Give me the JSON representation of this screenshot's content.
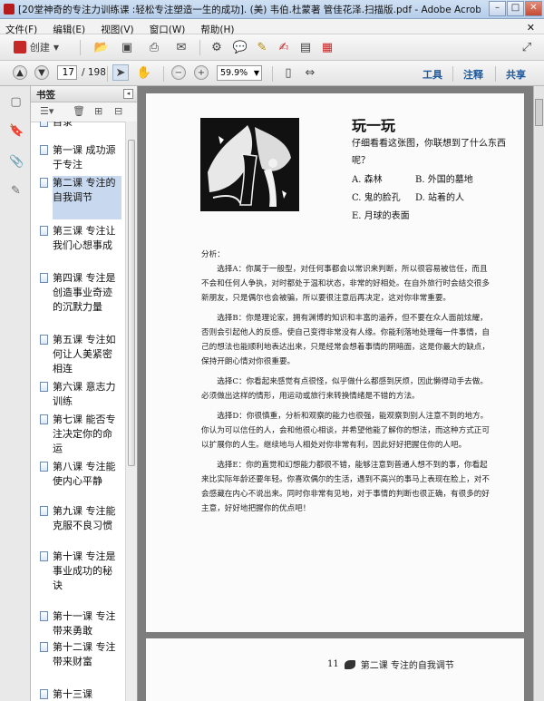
{
  "window": {
    "title": "[20堂神奇的专注力训练课 :轻松专注塑造一生的成功]. (美) 韦伯.杜蒙著 管佳花泽.扫描版.pdf - Adobe Acrobat Pro",
    "buttons": [
      "–",
      "□",
      "✕"
    ]
  },
  "menu": {
    "items": [
      "文件(F)",
      "编辑(E)",
      "视图(V)",
      "窗口(W)",
      "帮助(H)"
    ],
    "close": "✕"
  },
  "toolbar": {
    "create_label": "创建"
  },
  "nav": {
    "page_current": "17",
    "page_total": "/ 198",
    "zoom": "59.9%",
    "panels": [
      "工具",
      "注释",
      "共享"
    ]
  },
  "bookmarks": {
    "header": "书签",
    "items": [
      {
        "label": "目录",
        "selected": false
      },
      {
        "label": "第一课 成功源于专注",
        "selected": false
      },
      {
        "label": "第二课 专注的自我调节",
        "selected": true
      },
      {
        "label": "第三课 专注让我们心想事成",
        "selected": false
      },
      {
        "label": "第四课 专注是创造事业奇迹的沉默力量",
        "selected": false
      },
      {
        "label": "第五课 专注如何让人美紧密相连",
        "selected": false
      },
      {
        "label": "第六课 意志力训练",
        "selected": false
      },
      {
        "label": "第七课 能否专注决定你的命运",
        "selected": false
      },
      {
        "label": "第八课 专注能使内心平静",
        "selected": false
      },
      {
        "label": "第九课 专注能克服不良习惯",
        "selected": false
      },
      {
        "label": "第十课 专注是事业成功的秘诀",
        "selected": false
      },
      {
        "label": "第十一课 专注带来勇敢",
        "selected": false
      },
      {
        "label": "第十二课 专注带来财富",
        "selected": false
      },
      {
        "label": "第十三课",
        "selected": false
      }
    ]
  },
  "doc": {
    "heading": "玩一玩",
    "question": "仔细看看这张图，你联想到了什么东西呢？",
    "options": [
      [
        "A. 森林",
        "B. 外国的墓地"
      ],
      [
        "C. 鬼的脸孔",
        "D. 站着的人"
      ],
      [
        "E. 月球的表面",
        ""
      ]
    ],
    "analysis_title": "分析：",
    "paragraphs": [
      "选择A：你属于一般型，对任何事都会以常识来判断，所以很容易被信任，而且不会和任何人争执，对时都处于温和状态，非常的好相处。在自外旅行时会结交很多新朋友，只是偶尔也会被骗，所以要很注意后再决定，这对你非常重要。",
      "选择B：你是理论家，拥有渊博的知识和丰富的涵养，但不要在众人面前炫耀，否则会引起他人的反感。使自己变得非常没有人缘。你能利落地处理每一件事情，自己的想法也能顺利地表达出来，只是经常会想着事情的阴暗面，这是你最大的缺点，保持开朗心情对你很重要。",
      "选择C：你看起来感觉有点很怪，似乎做什么都感到厌烦，因此懒得动手去做。必须做出这样的情形，用运动或旅行来转换情绪是不错的方法。",
      "选择D：你很慎重，分析和观察的能力也很强，能观察到别人注意不到的地方。你认为可以信任的人，会和他很心相谈，并希望他能了解你的想法，而这种方式正可以扩展你的人生。继续地与人相处对你非常有利，因此好好把握住你的人吧。",
      "选择E：你的直觉和幻想能力都很不错，能够注意到普通人想不到的事，你看起来比实际年龄还要年轻。你喜欢偶尔的生活，遇到不高兴的事马上表现在脸上，对不会感藏在内心不说出来。同时你非常有见地，对于事情的判断也很正确，有很多的好主意，好好地把握你的优点吧！"
    ],
    "footer_page": "11",
    "footer_chapter": "第二课  专注的自我调节"
  }
}
